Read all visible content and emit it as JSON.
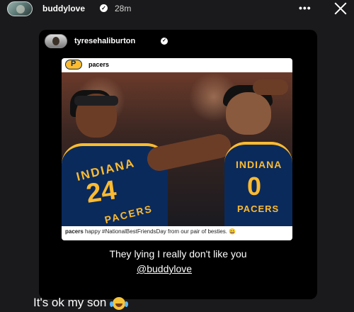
{
  "header": {
    "username": "buddylove",
    "verified_mark": "✓",
    "time": "28m",
    "more_label": "•••",
    "close_icon": "close-icon"
  },
  "shared_story": {
    "username": "tyresehaliburton",
    "verified_mark": "✓",
    "post": {
      "username": "pacers",
      "caption_user": "pacers",
      "caption_text": "happy #NationalBestFriendsDay from our pair of besties. 😀",
      "jersey_left_text": "INDIANA",
      "jersey_left_number": "24",
      "jersey_left_bottom": "PACERS",
      "jersey_right_text": "INDIANA",
      "jersey_right_number": "0",
      "jersey_right_bottom": "PACERS"
    },
    "sticker_text": "They lying I really don't like you",
    "mention": "@buddylove"
  },
  "reply": {
    "text": "It's ok my son",
    "emoji": "😂"
  },
  "colors": {
    "pacers_gold": "#fdbb30",
    "pacers_navy": "#0a2a5c",
    "background": "#1a1a1c"
  }
}
